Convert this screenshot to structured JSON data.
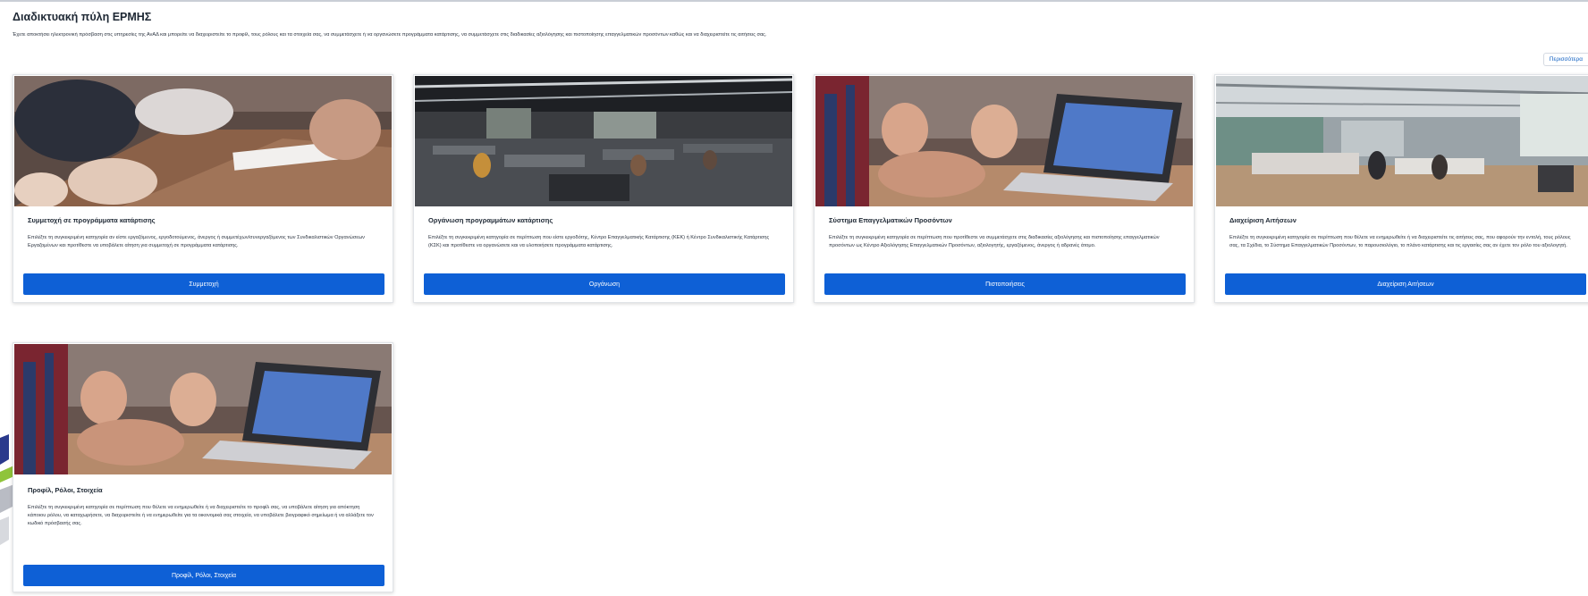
{
  "portal": {
    "title": "Διαδικτυακή πύλη ΕΡΜΗΣ",
    "description": "Έχετε αποκτήσει ηλεκτρονική πρόσβαση στις υπηρεσίες της ΑνΑΔ και μπορείτε να διαχειριστείτε το προφίλ, τους ρόλους και τα στοιχεία σας, να συμμετάσχετε ή να οργανώσετε προγράμματα κατάρτισης, να συμμετάσχετε στις διαδικασίες αξιολόγησης και πιστοποίησης επαγγελματικών προσόντων καθώς και να διαχειριστείτε τις αιτήσεις σας.",
    "more_label": "Περισσότερα"
  },
  "cards": [
    {
      "title": "Συμμετοχή σε προγράμματα κατάρτισης",
      "text": "Επιλέξτε τη συγκεκριμένη κατηγορία αν είστε εργαζόμενος, εργοδοτούμενος, άνεργος ή συμμετέχων/συνεργαζόμενος των Συνδικαλιστικών Οργανώσεων Εργαζομένων και προτίθεστε να υποβάλετε αίτηση για συμμετοχή σε προγράμματα κατάρτισης.",
      "button": "Συμμετοχή"
    },
    {
      "title": "Οργάνωση προγραμμάτων κατάρτισης",
      "text": "Επιλέξτε τη συγκεκριμένη κατηγορία σε περίπτωση που είστε εργοδότης, Κέντρο Επαγγελματικής Κατάρτισης (ΚΕΚ) ή Κέντρο Συνδικαλιστικής Κατάρτισης (ΚΣΚ) και προτίθεστε να οργανώσετε και να υλοποιήσετε προγράμματα κατάρτισης.",
      "button": "Οργάνωση"
    },
    {
      "title": "Σύστημα Επαγγελματικών Προσόντων",
      "text": "Επιλέξτε τη συγκεκριμένη κατηγορία σε περίπτωση που προτίθεστε να συμμετάσχετε στις διαδικασίες αξιολόγησης και πιστοποίησης επαγγελματικών προσόντων ως Κέντρο Αξιολόγησης Επαγγελματικών Προσόντων, αξιολογητής, εργαζόμενος, άνεργος ή αδρανές άτομο.",
      "button": "Πιστοποιήσεις"
    },
    {
      "title": "Διαχείριση Αιτήσεων",
      "text": "Επιλέξτε τη συγκεκριμένη κατηγορία σε περίπτωση που θέλετε να ενημερωθείτε ή να διαχειριστείτε τις αιτήσεις σας, που αφορούν την εντολή, τους ρόλους σας, τα Σχέδια, το Σύστημα Επαγγελματικών Προσόντων, το παρουσιολόγιο, το πλάνο κατάρτισης και τις εργασίες σας αν έχετε τον ρόλο του αξιολογητή.",
      "button": "Διαχείριση Αιτήσεων"
    },
    {
      "title": "Προφίλ, Ρόλοι, Στοιχεία",
      "text": "Επιλέξτε τη συγκεκριμένη κατηγορία σε περίπτωση που θέλετε να ενημερωθείτε ή να διαχειριστείτε το προφίλ σας, να υποβάλετε αίτηση για απόκτηση κάποιου ρόλου, να καταχωρήσετε, να διαχειριστείτε ή να ενημερωθείτε για τα οικονομικά σας στοιχεία, να υποβάλετε βιογραφικό σημείωμα ή να αλλάξετε τον κωδικό πρόσβασής σας.",
      "button": "Προφίλ, Ρόλοι, Στοιχεία"
    }
  ]
}
